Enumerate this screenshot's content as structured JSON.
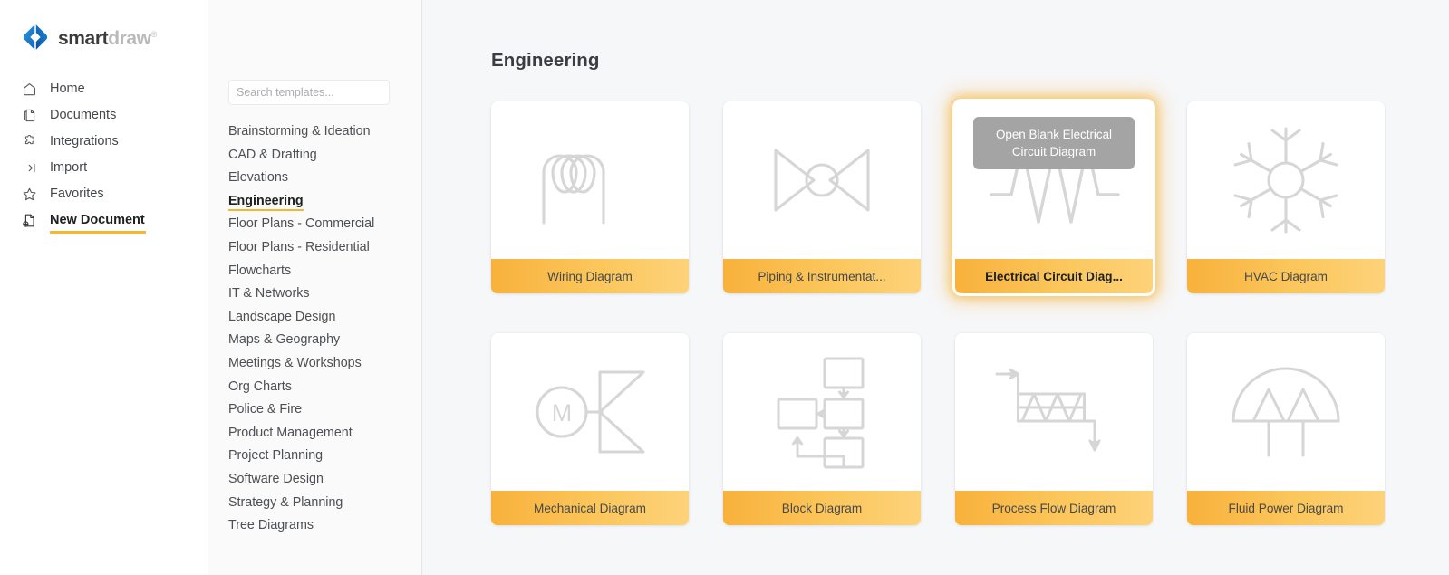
{
  "brand": {
    "smart": "smart",
    "draw": "draw",
    "tm": "®"
  },
  "nav": {
    "items": [
      {
        "label": "Home",
        "icon": "home-icon",
        "active": false
      },
      {
        "label": "Documents",
        "icon": "document-icon",
        "active": false
      },
      {
        "label": "Integrations",
        "icon": "puzzle-icon",
        "active": false
      },
      {
        "label": "Import",
        "icon": "import-arrow-icon",
        "active": false
      },
      {
        "label": "Favorites",
        "icon": "star-icon",
        "active": false
      },
      {
        "label": "New Document",
        "icon": "new-document-icon",
        "active": true
      }
    ]
  },
  "search": {
    "placeholder": "Search templates...",
    "value": "",
    "icon": "search-icon"
  },
  "categories": [
    {
      "label": "Brainstorming & Ideation",
      "active": false
    },
    {
      "label": "CAD & Drafting",
      "active": false
    },
    {
      "label": "Elevations",
      "active": false
    },
    {
      "label": "Engineering",
      "active": true
    },
    {
      "label": "Floor Plans - Commercial",
      "active": false
    },
    {
      "label": "Floor Plans - Residential",
      "active": false
    },
    {
      "label": "Flowcharts",
      "active": false
    },
    {
      "label": "IT & Networks",
      "active": false
    },
    {
      "label": "Landscape Design",
      "active": false
    },
    {
      "label": "Maps & Geography",
      "active": false
    },
    {
      "label": "Meetings & Workshops",
      "active": false
    },
    {
      "label": "Org Charts",
      "active": false
    },
    {
      "label": "Police & Fire",
      "active": false
    },
    {
      "label": "Product Management",
      "active": false
    },
    {
      "label": "Project Planning",
      "active": false
    },
    {
      "label": "Software Design",
      "active": false
    },
    {
      "label": "Strategy & Planning",
      "active": false
    },
    {
      "label": "Tree Diagrams",
      "active": false
    }
  ],
  "main": {
    "title": "Engineering",
    "tooltip": "Open Blank Electrical Circuit Diagram",
    "cards": [
      {
        "label": "Wiring Diagram",
        "icon": "coil-icon",
        "hovered": false
      },
      {
        "label": "Piping & Instrumentat...",
        "icon": "butterfly-valve-icon",
        "hovered": false
      },
      {
        "label": "Electrical Circuit Diag...",
        "icon": "resistor-waveform-icon",
        "hovered": true
      },
      {
        "label": "HVAC Diagram",
        "icon": "snowflake-icon",
        "hovered": false
      },
      {
        "label": "Mechanical Diagram",
        "icon": "motor-valve-icon",
        "hovered": false
      },
      {
        "label": "Block Diagram",
        "icon": "blocks-arrows-icon",
        "hovered": false
      },
      {
        "label": "Process Flow Diagram",
        "icon": "heat-exchanger-icon",
        "hovered": false
      },
      {
        "label": "Fluid Power Diagram",
        "icon": "pump-icon",
        "hovered": false
      }
    ]
  },
  "colors": {
    "accent": "#f5b731",
    "band_start": "#f8b13c",
    "band_end": "#fdd27a",
    "logo_blue": "#1573c4",
    "tooltip_bg": "#a4a4a4",
    "icon_gray": "#d6d6d6"
  }
}
